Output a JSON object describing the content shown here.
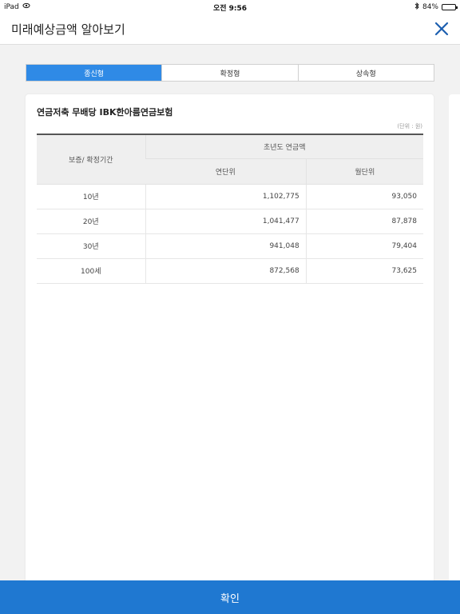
{
  "status_bar": {
    "device": "iPad",
    "time": "오전 9:56",
    "battery": "84%",
    "battery_level": 0.84
  },
  "header": {
    "title": "미래예상금액 알아보기"
  },
  "tabs": [
    {
      "label": "종신형",
      "active": true
    },
    {
      "label": "확정형",
      "active": false
    },
    {
      "label": "상속형",
      "active": false
    }
  ],
  "card": {
    "product_name": "연금저축 무배당 IBK한아름연금보험",
    "unit_note": "(단위 : 원)",
    "table": {
      "row_header": "보증/ 확정기간",
      "group_header": "초년도 연금액",
      "col_headers": [
        "연단위",
        "월단위"
      ],
      "rows": [
        {
          "period": "10년",
          "annual": "1,102,775",
          "monthly": "93,050"
        },
        {
          "period": "20년",
          "annual": "1,041,477",
          "monthly": "87,878"
        },
        {
          "period": "30년",
          "annual": "941,048",
          "monthly": "79,404"
        },
        {
          "period": "100세",
          "annual": "872,568",
          "monthly": "73,625"
        }
      ]
    }
  },
  "footer": {
    "confirm_label": "확인"
  },
  "colors": {
    "accent": "#2f8ae6",
    "confirm": "#1f78d1"
  }
}
